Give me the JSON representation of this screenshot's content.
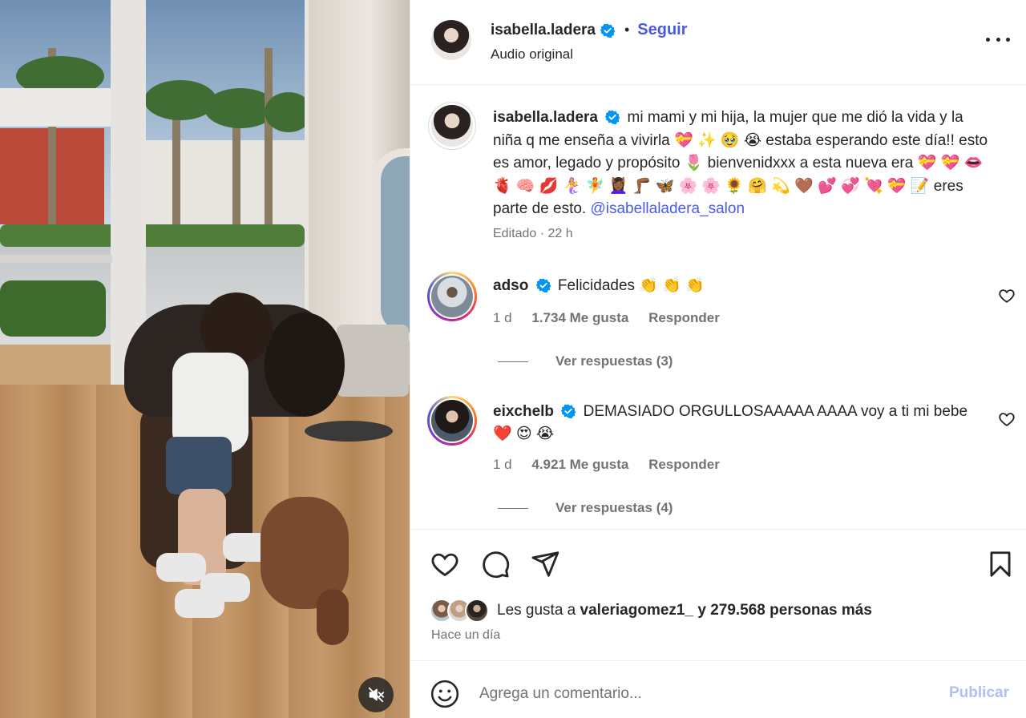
{
  "post": {
    "author": "isabella.ladera",
    "follow_label": "Seguir",
    "separator": "•",
    "audio": "Audio original",
    "more_icon": "more-horizontal-icon"
  },
  "caption": {
    "author": "isabella.ladera",
    "text": "mi mami y mi hija, la mujer que me dió la vida y la niña q me enseña a vivirla 💝 ✨ 🥹 😭  estaba esperando este día!! esto es amor, legado y propósito 🌷  bienvenidxxx a esta nueva era 💝 💝 👄 🫀 🧠 💋 🧜‍♀️ 🧚 💆🏾‍♀️ 🦵🏾 🦋 🌸 🌸 🌻 🤗 💫 🤎 💕 💞 💘 💝 📝 eres parte de esto.",
    "mention": "@isabellaladera_salon",
    "meta": "Editado · 22 h"
  },
  "comments": [
    {
      "user": "adso",
      "text": "Felicidades 👏 👏 👏",
      "age": "1 d",
      "likes": "1.734 Me gusta",
      "reply": "Responder",
      "view_replies": "Ver respuestas (3)"
    },
    {
      "user": "eixchelb",
      "text": "DEMASIADO ORGULLOSAAAAA AAAA voy a ti mi bebe ❤️ 😍 😭",
      "age": "1 d",
      "likes": "4.921 Me gusta",
      "reply": "Responder",
      "view_replies": "Ver respuestas (4)"
    }
  ],
  "actions": {
    "likes_prefix": "Les gusta a",
    "likes_user": "valeriagomez1_",
    "likes_suffix": "y 279.568 personas más",
    "date": "Hace un día"
  },
  "add_comment": {
    "placeholder": "Agrega un comentario...",
    "publish_label": "Publicar"
  },
  "colors": {
    "link_blue": "#4a5ae8",
    "verified_blue": "#0095f6",
    "publish_disabled": "#b3bdf6",
    "secondary_text": "#737373"
  }
}
